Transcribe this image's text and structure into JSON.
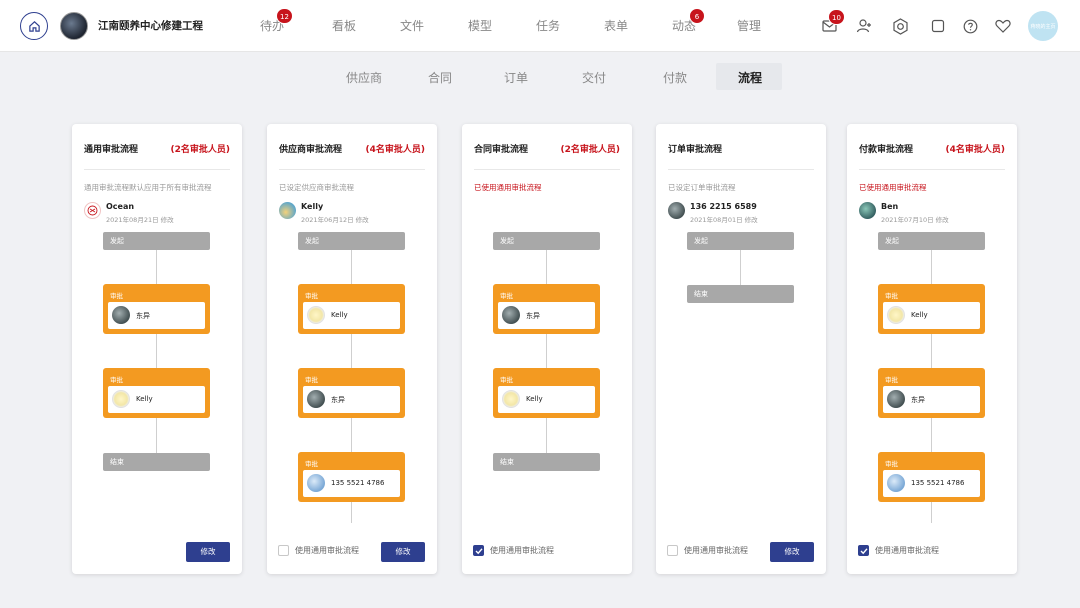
{
  "header": {
    "project_title": "江南颐养中心修建工程",
    "nav": [
      {
        "label": "待办",
        "badge": "12"
      },
      {
        "label": "看板"
      },
      {
        "label": "文件"
      },
      {
        "label": "模型"
      },
      {
        "label": "任务"
      },
      {
        "label": "表单"
      },
      {
        "label": "动态",
        "badge": "6"
      },
      {
        "label": "管理"
      }
    ],
    "mail_badge": "10",
    "user_avatar_text": "蒋晓的主页"
  },
  "subtabs": [
    "供应商",
    "合同",
    "订单",
    "交付",
    "付款",
    "流程"
  ],
  "active_subtab": "流程",
  "cards": [
    {
      "title": "通用审批流程",
      "count": "(2名审批人员)",
      "desc": "通用审批流程默认应用于所有审批流程",
      "editor": "Ocean",
      "date": "2021年08月21日 修改",
      "start": "发起",
      "approval": "审批",
      "end": "结束",
      "approvers": [
        "东异",
        "Kelly"
      ],
      "edit": "修改"
    },
    {
      "title": "供应商审批流程",
      "count": "(4名审批人员)",
      "desc": "已设定供应商审批流程",
      "editor": "Kelly",
      "date": "2021年06月12日 修改",
      "start": "发起",
      "approval": "审批",
      "approvers": [
        "Kelly",
        "东异",
        "135 5521 4786"
      ],
      "use_general": "使用通用审批流程",
      "edit": "修改"
    },
    {
      "title": "合同审批流程",
      "count": "(2名审批人员)",
      "desc": "已使用通用审批流程",
      "start": "发起",
      "approval": "审批",
      "end": "结束",
      "approvers": [
        "东异",
        "Kelly"
      ],
      "use_general": "使用通用审批流程"
    },
    {
      "title": "订单审批流程",
      "desc": "已设定订单审批流程",
      "editor": "136 2215 6589",
      "date": "2021年08月01日 修改",
      "start": "发起",
      "end": "结束",
      "use_general": "使用通用审批流程",
      "edit": "修改"
    },
    {
      "title": "付款审批流程",
      "count": "(4名审批人员)",
      "desc": "已使用通用审批流程",
      "editor": "Ben",
      "date": "2021年07月10日 修改",
      "start": "发起",
      "approval": "审批",
      "approvers": [
        "Kelly",
        "东异",
        "135 5521 4786"
      ],
      "use_general": "使用通用审批流程"
    }
  ],
  "colors": {
    "primary": "#2e3f8f",
    "accent": "#f39a21",
    "alert": "#c7141c",
    "node": "#a8a8a8"
  }
}
